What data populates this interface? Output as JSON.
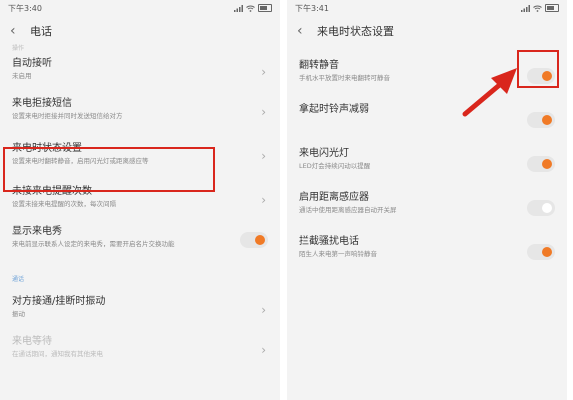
{
  "left": {
    "status": {
      "time": "下午3:40"
    },
    "header": {
      "title": "电话"
    },
    "top_cut": "操作",
    "items": [
      {
        "title": "自动接听",
        "sub": "未启用",
        "control": "chevron"
      },
      {
        "title": "来电拒接短信",
        "sub": "设置来电时拒接并同时发送短信给对方",
        "control": "chevron"
      },
      {
        "title": "来电时状态设置",
        "sub": "设置来电时翻转静音，启用闪光灯或距离感应等",
        "control": "chevron"
      },
      {
        "title": "未接来电提醒次数",
        "sub": "设置未接来电提醒的次数，每次间隔",
        "control": "chevron"
      },
      {
        "title": "显示来电秀",
        "sub": "来电前显示联系人设定的来电秀，需要开启名片交换功能",
        "control": "toggle"
      }
    ],
    "section": "通话",
    "items2": [
      {
        "title": "对方接通/挂断时振动",
        "sub": "振动",
        "control": "chevron"
      },
      {
        "title": "来电等待",
        "sub": "在通话期间，通知我有其他来电",
        "control": "chevron"
      }
    ]
  },
  "right": {
    "status": {
      "time": "下午3:41"
    },
    "header": {
      "title": "来电时状态设置"
    },
    "items": [
      {
        "title": "翻转静音",
        "sub": "手机水平放置时来电翻转可静音",
        "on": true
      },
      {
        "title": "拿起时铃声减弱",
        "sub": "",
        "on": true
      },
      {
        "title": "来电闪光灯",
        "sub": "LED灯会持续闪动以提醒",
        "on": true
      },
      {
        "title": "启用距离感应器",
        "sub": "通话中使用距离感应器自动开关屏",
        "on": false
      },
      {
        "title": "拦截骚扰电话",
        "sub": "陌生人来电第一声响铃静音",
        "on": true
      }
    ]
  },
  "colors": {
    "accent": "#f07a26",
    "highlight": "#d9261c"
  }
}
